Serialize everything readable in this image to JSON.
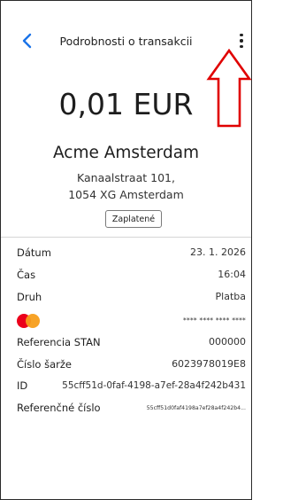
{
  "header": {
    "title": "Podrobnosti o transakcii",
    "back_icon": "chevron-left-icon",
    "more_icon": "more-vertical-icon",
    "accent_color": "#1a73e8",
    "annotation_color": "#e00000"
  },
  "transaction": {
    "amount": "0,01 EUR",
    "merchant": "Acme Amsterdam",
    "address_line1": "Kanaalstraat 101,",
    "address_line2": "1054 XG Amsterdam",
    "status": "Zaplatené"
  },
  "details": {
    "date_label": "Dátum",
    "date_value": "23. 1. 2026",
    "time_label": "Čas",
    "time_value": "16:04",
    "type_label": "Druh",
    "type_value": "Platba",
    "card_icon": "mastercard-icon",
    "card_value": "**** **** **** ****",
    "stan_label": "Referencia STAN",
    "stan_value": "000000",
    "batch_label": "Číslo šarže",
    "batch_value": "6023978019E8",
    "id_label": "ID",
    "id_value": "55cff51d-0faf-4198-a7ef-28a4f242b431",
    "ref_label": "Referenčné číslo",
    "ref_value": "55cff51d0faf4198a7ef28a4f242b4..."
  }
}
